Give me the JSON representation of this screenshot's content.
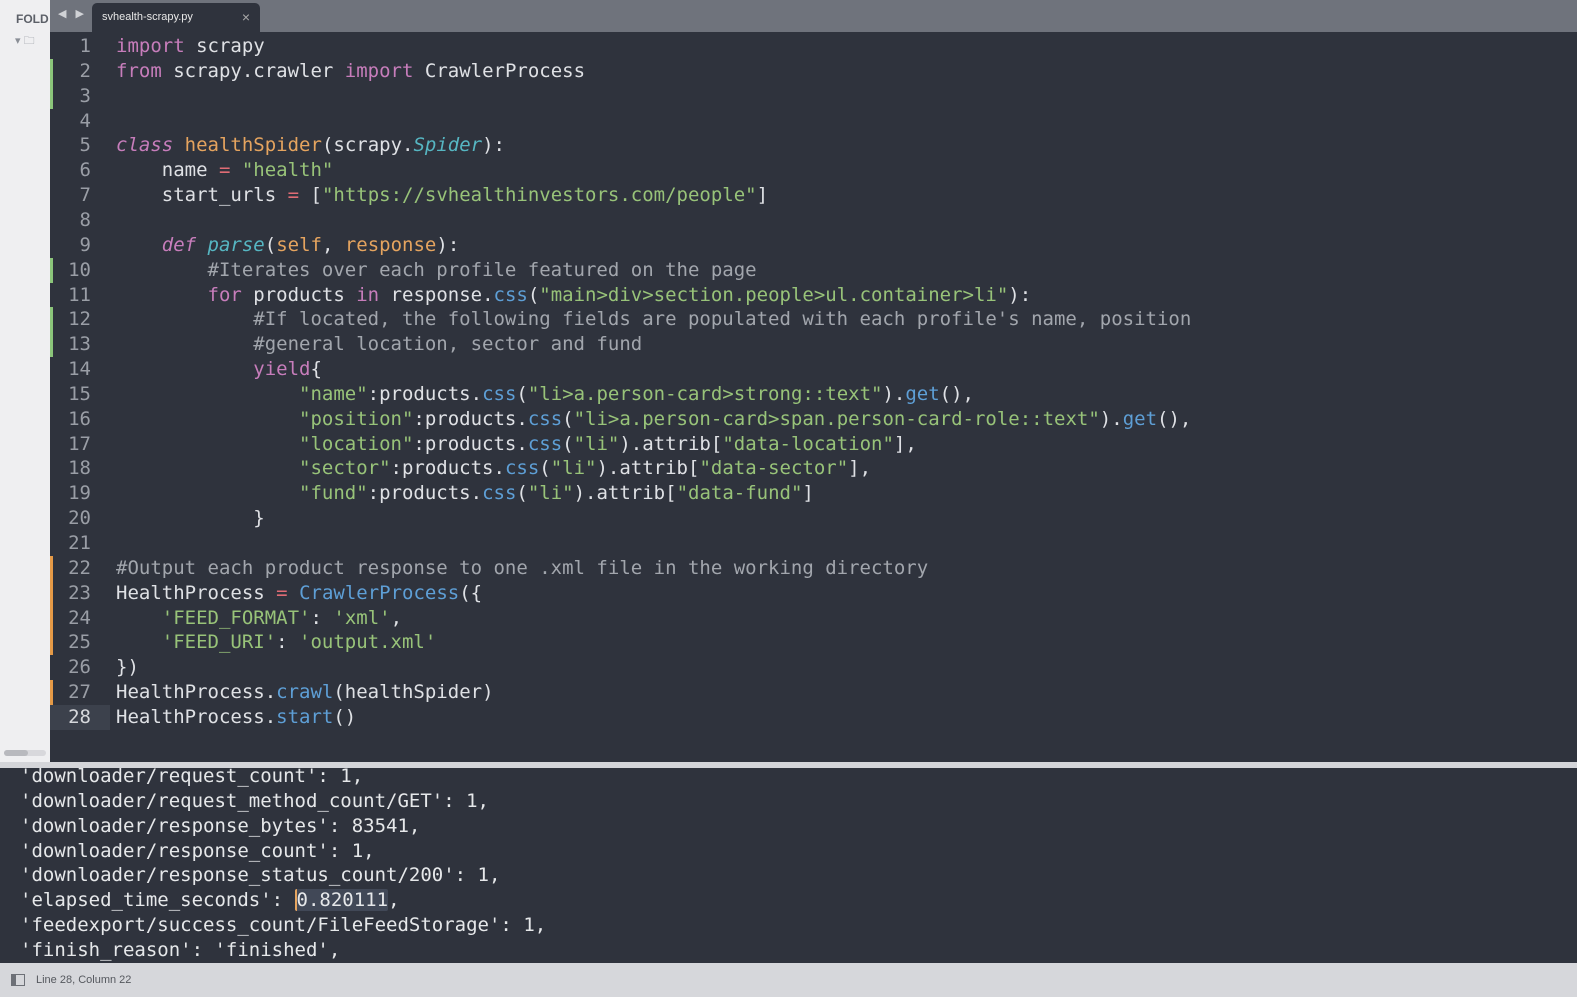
{
  "sidebar": {
    "label": "FOLD"
  },
  "tab": {
    "title": "svhealth-scrapy.py",
    "close": "×",
    "nav": "◀ ▶"
  },
  "colors": {
    "added": "#8bc57a",
    "modified": "#e59a47"
  },
  "code": [
    {
      "n": "1",
      "t": [
        [
          "import",
          "kw"
        ],
        [
          " scrapy",
          "df"
        ]
      ]
    },
    {
      "n": "2",
      "m": "added",
      "t": [
        [
          "from",
          "kw"
        ],
        [
          " scrapy.crawler ",
          "df"
        ],
        [
          "import",
          "kw"
        ],
        [
          " CrawlerProcess",
          "df"
        ]
      ]
    },
    {
      "n": "3",
      "m": "added",
      "t": []
    },
    {
      "n": "4",
      "t": []
    },
    {
      "n": "5",
      "t": [
        [
          "class",
          "ik"
        ],
        [
          " ",
          "df"
        ],
        [
          "healthSpider",
          "nm"
        ],
        [
          "(scrapy.",
          "df"
        ],
        [
          "Spider",
          "it"
        ],
        [
          "):",
          "df"
        ]
      ]
    },
    {
      "n": "6",
      "t": [
        [
          "    name ",
          "df"
        ],
        [
          "=",
          "op"
        ],
        [
          " ",
          "df"
        ],
        [
          "\"health\"",
          "st"
        ]
      ]
    },
    {
      "n": "7",
      "t": [
        [
          "    start_urls ",
          "df"
        ],
        [
          "=",
          "op"
        ],
        [
          " [",
          "df"
        ],
        [
          "\"https://svhealthinvestors.com/people\"",
          "st"
        ],
        [
          "]",
          "df"
        ]
      ]
    },
    {
      "n": "8",
      "t": []
    },
    {
      "n": "9",
      "t": [
        [
          "    ",
          "df"
        ],
        [
          "def",
          "ik"
        ],
        [
          " ",
          "df"
        ],
        [
          "parse",
          "it"
        ],
        [
          "(",
          "df"
        ],
        [
          "self",
          "nm"
        ],
        [
          ", ",
          "df"
        ],
        [
          "response",
          "nm"
        ],
        [
          "):",
          "df"
        ]
      ]
    },
    {
      "n": "10",
      "m": "added",
      "t": [
        [
          "        #Iterates over each profile featured on the page",
          "cm"
        ]
      ]
    },
    {
      "n": "11",
      "t": [
        [
          "        ",
          "df"
        ],
        [
          "for",
          "kw"
        ],
        [
          " products ",
          "df"
        ],
        [
          "in",
          "kw"
        ],
        [
          " response.",
          "df"
        ],
        [
          "css",
          "bi"
        ],
        [
          "(",
          "df"
        ],
        [
          "\"main>div>section.people>ul.container>li\"",
          "st"
        ],
        [
          "):",
          "df"
        ]
      ]
    },
    {
      "n": "12",
      "m": "added",
      "t": [
        [
          "            #If located, the following fields are populated with each profile's name, position",
          "cm"
        ]
      ]
    },
    {
      "n": "13",
      "m": "added",
      "t": [
        [
          "            #general location, sector and fund",
          "cm"
        ]
      ]
    },
    {
      "n": "14",
      "t": [
        [
          "            ",
          "df"
        ],
        [
          "yield",
          "kw"
        ],
        [
          "{",
          "df"
        ]
      ]
    },
    {
      "n": "15",
      "t": [
        [
          "                ",
          "df"
        ],
        [
          "\"name\"",
          "st"
        ],
        [
          ":products.",
          "df"
        ],
        [
          "css",
          "bi"
        ],
        [
          "(",
          "df"
        ],
        [
          "\"li>a.person-card>strong::text\"",
          "st"
        ],
        [
          ").",
          "df"
        ],
        [
          "get",
          "bi"
        ],
        [
          "(),",
          "df"
        ]
      ]
    },
    {
      "n": "16",
      "t": [
        [
          "                ",
          "df"
        ],
        [
          "\"position\"",
          "st"
        ],
        [
          ":products.",
          "df"
        ],
        [
          "css",
          "bi"
        ],
        [
          "(",
          "df"
        ],
        [
          "\"li>a.person-card>span.person-card-role::text\"",
          "st"
        ],
        [
          ").",
          "df"
        ],
        [
          "get",
          "bi"
        ],
        [
          "(),",
          "df"
        ]
      ]
    },
    {
      "n": "17",
      "t": [
        [
          "                ",
          "df"
        ],
        [
          "\"location\"",
          "st"
        ],
        [
          ":products.",
          "df"
        ],
        [
          "css",
          "bi"
        ],
        [
          "(",
          "df"
        ],
        [
          "\"li\"",
          "st"
        ],
        [
          ").attrib[",
          "df"
        ],
        [
          "\"data-location\"",
          "st"
        ],
        [
          "],",
          "df"
        ]
      ]
    },
    {
      "n": "18",
      "t": [
        [
          "                ",
          "df"
        ],
        [
          "\"sector\"",
          "st"
        ],
        [
          ":products.",
          "df"
        ],
        [
          "css",
          "bi"
        ],
        [
          "(",
          "df"
        ],
        [
          "\"li\"",
          "st"
        ],
        [
          ").attrib[",
          "df"
        ],
        [
          "\"data-sector\"",
          "st"
        ],
        [
          "],",
          "df"
        ]
      ]
    },
    {
      "n": "19",
      "t": [
        [
          "                ",
          "df"
        ],
        [
          "\"fund\"",
          "st"
        ],
        [
          ":products.",
          "df"
        ],
        [
          "css",
          "bi"
        ],
        [
          "(",
          "df"
        ],
        [
          "\"li\"",
          "st"
        ],
        [
          ").attrib[",
          "df"
        ],
        [
          "\"data-fund\"",
          "st"
        ],
        [
          "]",
          "df"
        ]
      ]
    },
    {
      "n": "20",
      "t": [
        [
          "            }",
          "df"
        ]
      ]
    },
    {
      "n": "21",
      "t": []
    },
    {
      "n": "22",
      "m": "modified",
      "t": [
        [
          "#Output each product response to one .xml file in the working directory",
          "cm"
        ]
      ]
    },
    {
      "n": "23",
      "m": "modified",
      "t": [
        [
          "HealthProcess ",
          "df"
        ],
        [
          "=",
          "op"
        ],
        [
          " ",
          "df"
        ],
        [
          "CrawlerProcess",
          "bi"
        ],
        [
          "({",
          "df"
        ]
      ]
    },
    {
      "n": "24",
      "m": "modified",
      "t": [
        [
          "    ",
          "df"
        ],
        [
          "'FEED_FORMAT'",
          "st"
        ],
        [
          ": ",
          "df"
        ],
        [
          "'xml'",
          "st"
        ],
        [
          ",",
          "df"
        ]
      ]
    },
    {
      "n": "25",
      "m": "modified",
      "t": [
        [
          "    ",
          "df"
        ],
        [
          "'FEED_URI'",
          "st"
        ],
        [
          ": ",
          "df"
        ],
        [
          "'output.xml'",
          "st"
        ]
      ]
    },
    {
      "n": "26",
      "t": [
        [
          "})",
          "df"
        ]
      ]
    },
    {
      "n": "27",
      "m": "modified",
      "t": [
        [
          "HealthProcess.",
          "df"
        ],
        [
          "crawl",
          "bi"
        ],
        [
          "(healthSpider)",
          "df"
        ]
      ]
    },
    {
      "n": "28",
      "m": "modified",
      "cur": true,
      "t": [
        [
          "HealthProcess.",
          "df"
        ],
        [
          "start",
          "bi"
        ],
        [
          "()",
          "df"
        ]
      ]
    }
  ],
  "console": [
    "'downloader/request_count': 1,",
    "'downloader/request_method_count/GET': 1,",
    "'downloader/response_bytes': 83541,",
    "'downloader/response_count': 1,",
    "'downloader/response_status_count/200': 1,",
    {
      "pre": "'elapsed_time_seconds': ",
      "sel": "0.820111",
      "post": ","
    },
    "'feedexport/success_count/FileFeedStorage': 1,",
    "'finish_reason': 'finished',"
  ],
  "status": {
    "position": "Line 28, Column 22"
  }
}
